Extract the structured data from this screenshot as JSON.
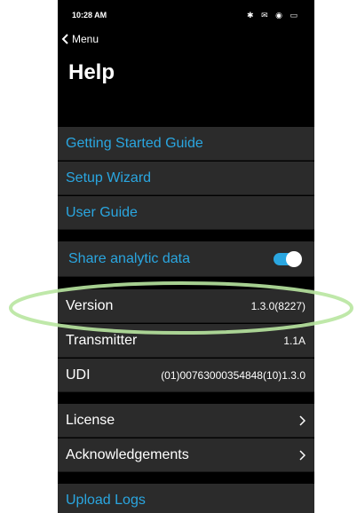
{
  "status_bar": {
    "time": "10:28 AM",
    "right_icons": "✱ ✉ ◉ ▭"
  },
  "nav": {
    "back_label": "Menu"
  },
  "page": {
    "title": "Help"
  },
  "section1": {
    "getting_started": "Getting Started Guide",
    "setup_wizard": "Setup Wizard",
    "user_guide": "User Guide"
  },
  "section2": {
    "share_analytic": "Share analytic data",
    "toggle_on": true
  },
  "info": {
    "version_label": "Version",
    "version_value": "1.3.0(8227)",
    "transmitter_label": "Transmitter",
    "transmitter_value": "1.1A",
    "udi_label": "UDI",
    "udi_value": "(01)00763000354848(10)1.3.0"
  },
  "section4": {
    "license": "License",
    "acknowledgements": "Acknowledgements"
  },
  "section5": {
    "upload_logs": "Upload Logs"
  },
  "colors": {
    "accent": "#2aa6e0",
    "row_bg": "#2b2b2b",
    "background": "#000000",
    "highlight": "#b8e6a0"
  },
  "icons": [
    "chevron-left-icon",
    "chevron-right-icon",
    "toggle-switch"
  ]
}
